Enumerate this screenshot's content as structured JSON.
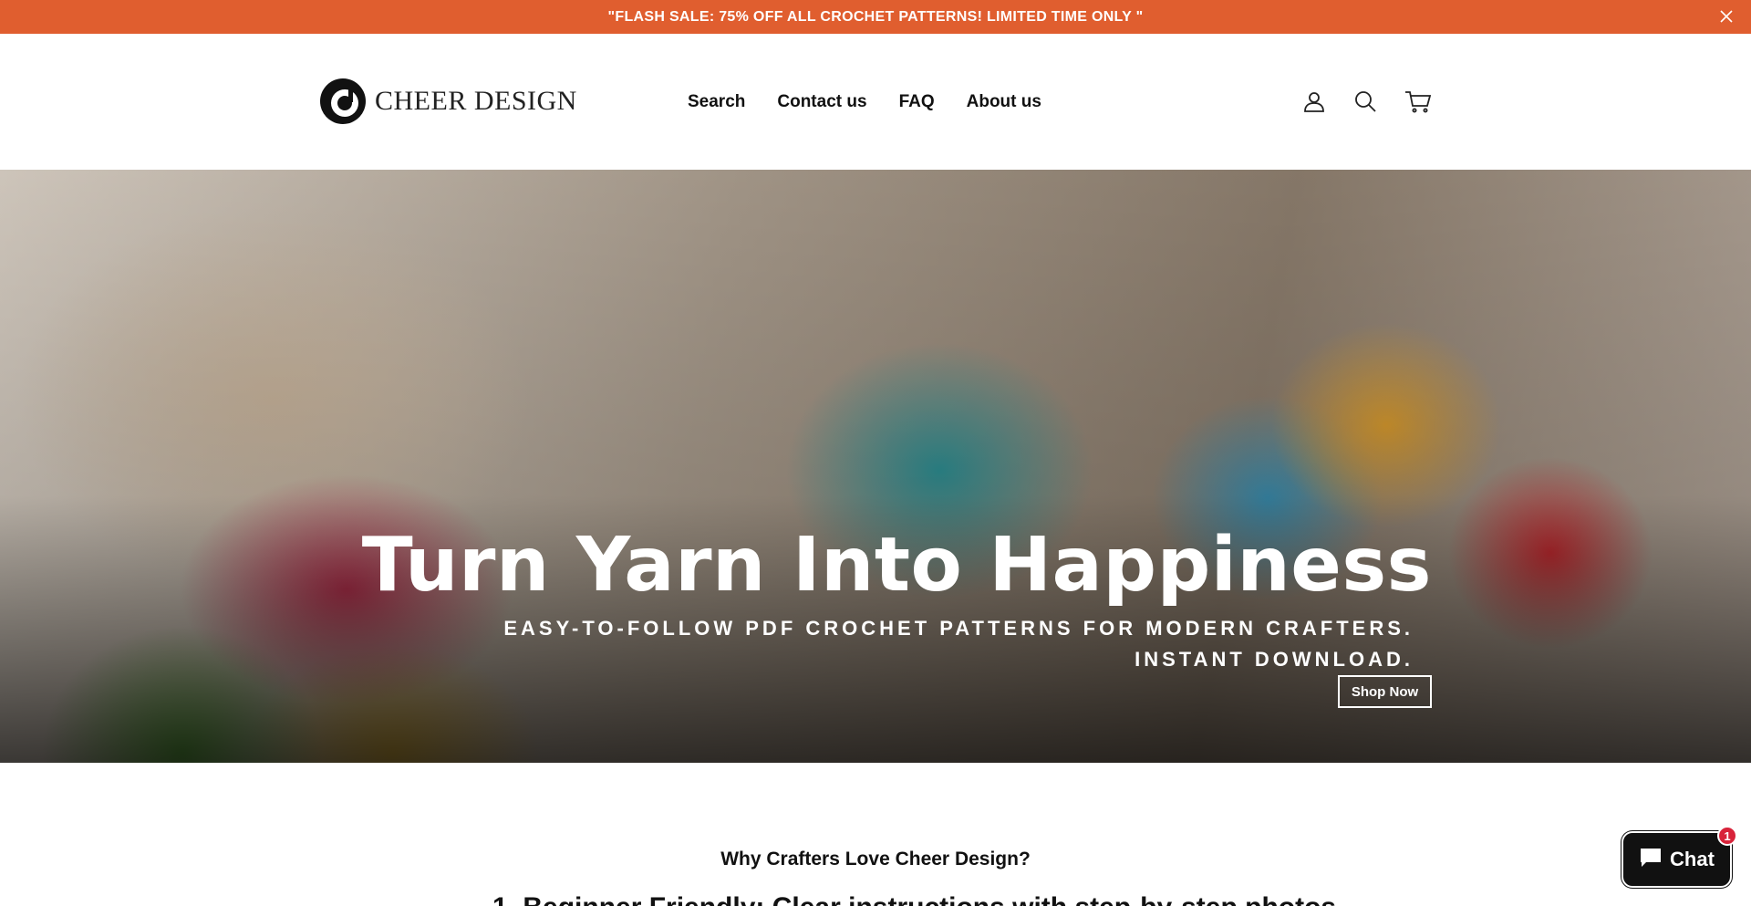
{
  "announcement": {
    "text": "\"FLASH SALE: 75% OFF ALL CROCHET PATTERNS! LIMITED TIME ONLY    \"",
    "close_icon": "close-icon",
    "bg_color": "#e05e2f"
  },
  "header": {
    "logo_text": "CHEER DESIGN",
    "nav": [
      {
        "label": "Search"
      },
      {
        "label": "Contact us"
      },
      {
        "label": "FAQ"
      },
      {
        "label": "About us"
      }
    ],
    "icons": [
      "account-icon",
      "search-icon",
      "cart-icon"
    ]
  },
  "hero": {
    "title": "Turn Yarn Into Happiness",
    "subtitle": "EASY-TO-FOLLOW PDF CROCHET PATTERNS FOR MODERN CRAFTERS. INSTANT DOWNLOAD.",
    "button": "Shop Now"
  },
  "section": {
    "heading": "Why Crafters Love Cheer Design?",
    "first_item_partial": "1. Beginner Friendly: Clear instructions with step-by-step photos"
  },
  "chat": {
    "label": "Chat",
    "badge": "1",
    "icon": "chat-bubble-icon"
  }
}
